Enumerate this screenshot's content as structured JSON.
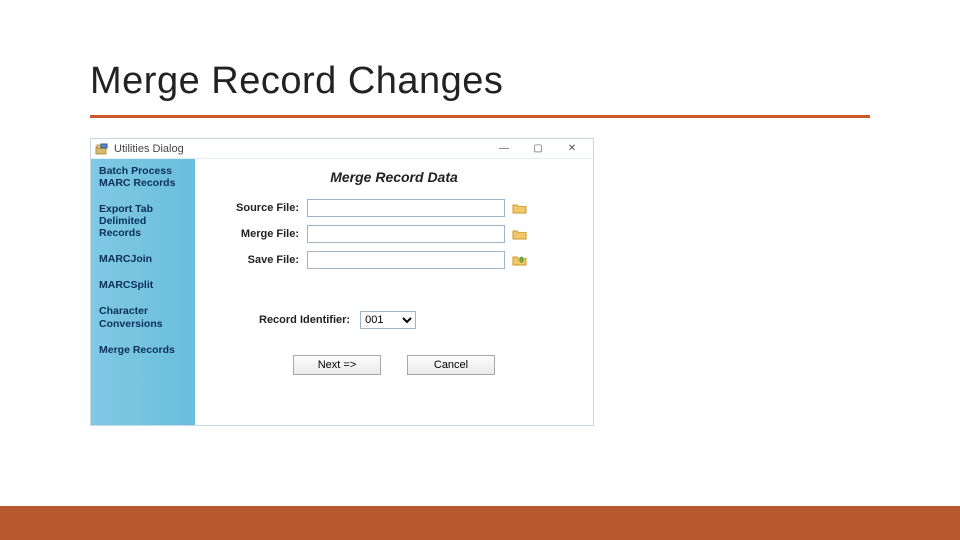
{
  "slide": {
    "title": "Merge Record Changes"
  },
  "window": {
    "title": "Utilities Dialog",
    "controls": {
      "min": "—",
      "max": "▢",
      "close": "✕"
    }
  },
  "sidebar": {
    "items": [
      {
        "label": "Batch Process\nMARC Records"
      },
      {
        "label": "Export Tab\nDelimited\nRecords"
      },
      {
        "label": "MARCJoin"
      },
      {
        "label": "MARCSplit"
      },
      {
        "label": "Character\nConversions"
      },
      {
        "label": "Merge Records"
      }
    ]
  },
  "main": {
    "panel_title": "Merge Record Data",
    "source_label": "Source File:",
    "source_value": "",
    "merge_label": "Merge File:",
    "merge_value": "",
    "save_label": "Save File:",
    "save_value": "",
    "identifier_label": "Record Identifier:",
    "identifier_selected": "001",
    "next_label": "Next =>",
    "cancel_label": "Cancel"
  }
}
